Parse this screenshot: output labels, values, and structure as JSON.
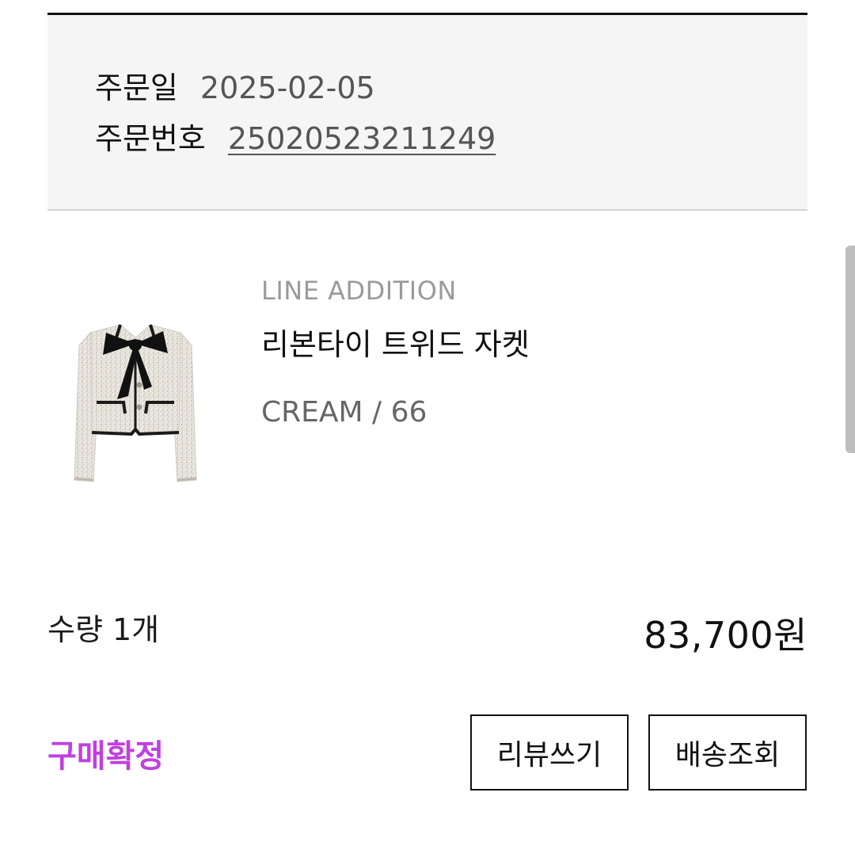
{
  "order": {
    "date_label": "주문일",
    "date_value": "2025-02-05",
    "number_label": "주문번호",
    "number_value": "25020523211249"
  },
  "product": {
    "image_icon": "tweed-jacket-with-ribbon-tie-image",
    "brand": "LINE ADDITION",
    "name": "리본타이 트위드 자켓",
    "option": "CREAM / 66"
  },
  "summary": {
    "quantity": "수량 1개",
    "price": "83,700원"
  },
  "status": {
    "label": "구매확정",
    "color": "#c040e0"
  },
  "actions": {
    "review_label": "리뷰쓰기",
    "tracking_label": "배송조회"
  }
}
